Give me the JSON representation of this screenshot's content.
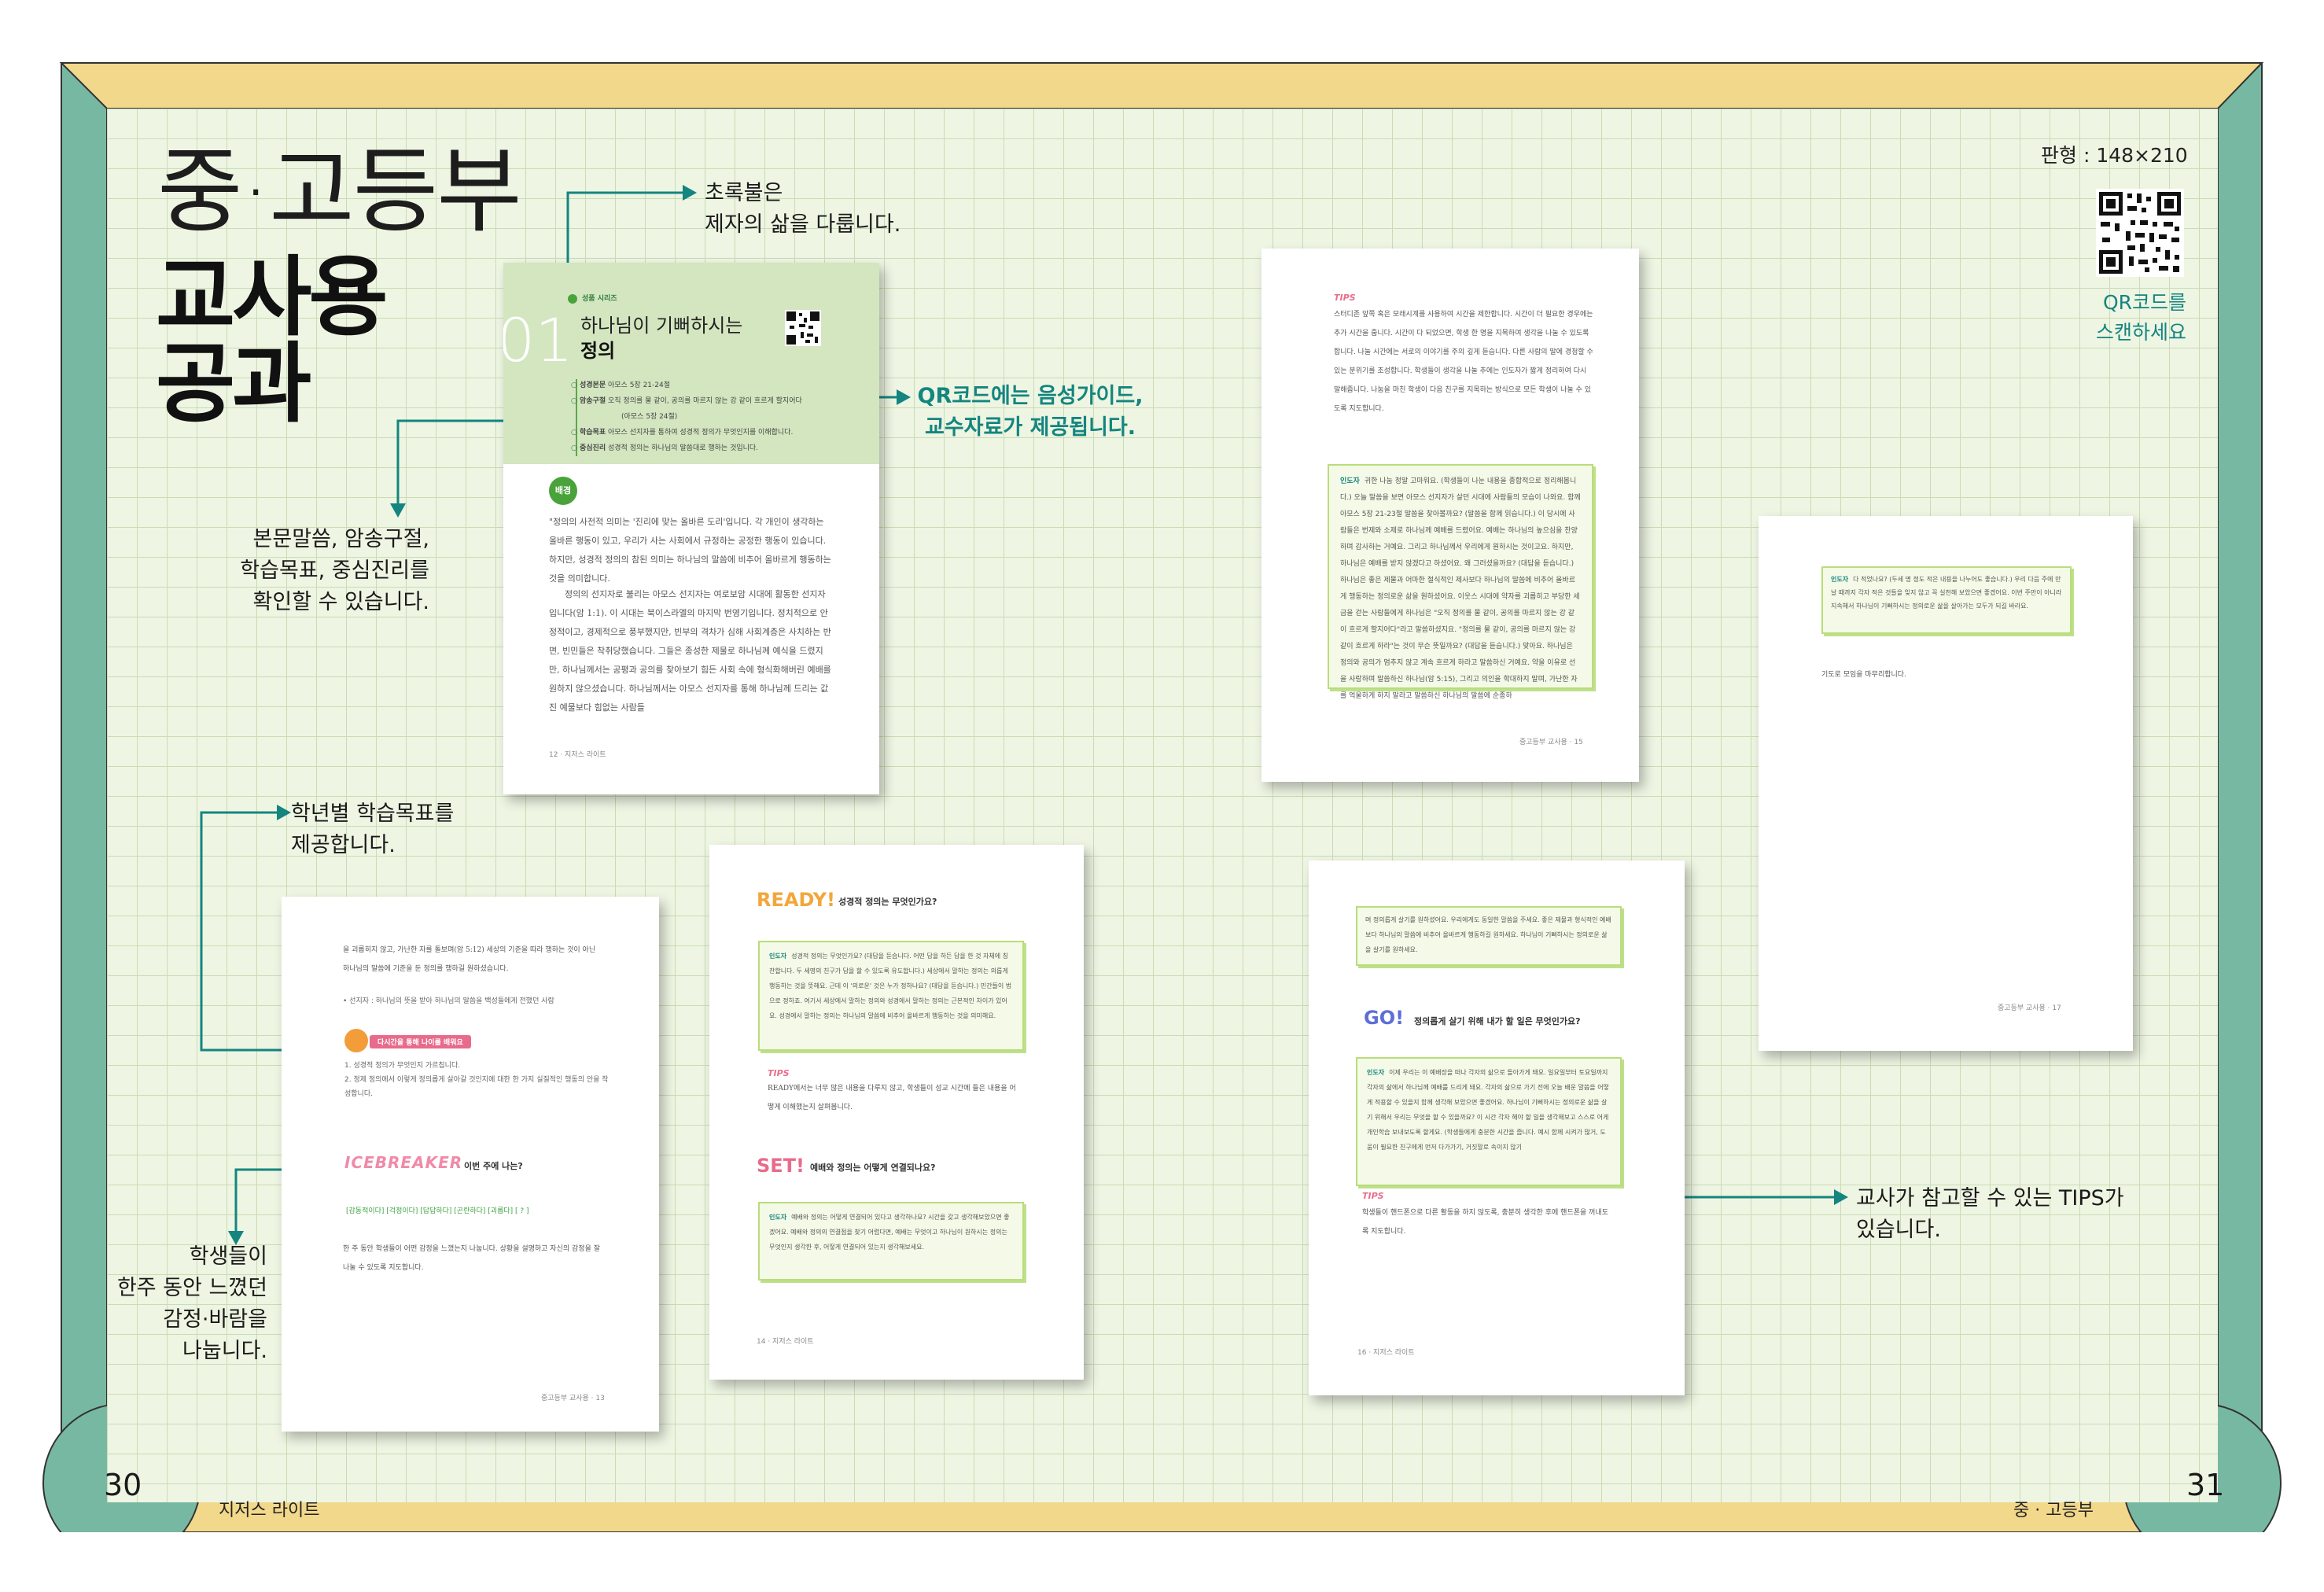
{
  "hero": {
    "line1": "중·고등부",
    "line2": "교사용",
    "line3": "공과"
  },
  "format": {
    "label": "판형 : 148×210",
    "qr_caption_line1": "QR코드를",
    "qr_caption_line2": "스캔하세요"
  },
  "callouts": {
    "green_light_line1": "초록불은",
    "green_light_line2": "제자의 삶을 다룹니다.",
    "qr_line1": "QR코드에는 음성가이드,",
    "qr_line2": "교수자료가 제공됩니다.",
    "scripture_line1": "본문말씀, 암송구절,",
    "scripture_line2": "학습목표, 중심진리를",
    "scripture_line3": "확인할 수 있습니다.",
    "grade_line1": "학년별 학습목표를",
    "grade_line2": "제공합니다.",
    "students_line1": "학생들이",
    "students_line2": "한주 동안 느꼈던",
    "students_line3": "감정·바람을",
    "students_line4": "나눕니다.",
    "tips_line1": "교사가 참고할 수 있는 TIPS가",
    "tips_line2": "있습니다."
  },
  "lesson_page": {
    "series_label": "성품 시리즈",
    "number": "01",
    "title_light": "하나님이 기뻐하시는",
    "title_bold": "정의",
    "items": [
      {
        "key": "성경본문",
        "value": "아모스 5장 21-24절"
      },
      {
        "key": "암송구절",
        "value": "오직 정의를 물 같이, 공의를 마르지 않는 강 같이 흐르게 할지어다"
      },
      {
        "key": "",
        "value": "(아모스 5장 24절)"
      },
      {
        "key": "학습목표",
        "value": "아모스 선지자를 통하여 성경적 정의가 무엇인지를 이해합니다."
      },
      {
        "key": "중심진리",
        "value": "성경적 정의는 하나님의 말씀대로 행하는 것입니다."
      }
    ],
    "background_badge": "배경",
    "paragraphs": [
      "\"정의의 사전적 의미는 '진리에 맞는 올바른 도리'입니다. 각 개인이 생각하는 올바른 행동이 있고, 우리가 사는 사회에서 규정하는 공정한 행동이 있습니다. 하지만, 성경적 정의의 참된 의미는 하나님의 말씀에 비추어 올바르게 행동하는 것을 의미합니다.",
      "정의의 선지자로 불리는 아모스 선지자는 여로보암 시대에 활동한 선지자입니다(암 1:1). 이 시대는 북이스라엘의 마지막 번영기입니다. 정치적으로 안정적이고, 경제적으로 풍부했지만, 빈부의 격차가 심해 사회계층은 사치하는 반면, 빈민들은 착취당했습니다. 그들은 종성한 제물로 하나님께 예식을 드렸지만, 하나님께서는 공평과 공의를 찾아보기 힘든 사회 속에 형식화해버린 예배를 원하지 않으셨습니다. 하나님께서는 아모스 선지자를 통해 하나님께 드리는 값진 예물보다 힘없는 사람들"
    ],
    "footer": "12 · 지저스 라이트"
  },
  "page15": {
    "tips_title": "TIPS",
    "tips_text": "스터디존 앞쪽 혹은 모래시계를 사용하여 시간을 제한합니다. 시간이 더 필요한 경우에는 추가 시간을 줍니다. 시간이 다 되었으면, 학생 한 명을 지목하여 생각을 나눌 수 있도록 합니다. 나눌 시간에는 서로의 이야기를 주의 깊게 듣습니다. 다른 사람의 말에 경청할 수 있는 분위기를 조성합니다. 학생들이 생각을 나눌 추에는 인도자가 짧게 정리하여 다시 말해줍니다. 나눔을 마친 학생이 다음 친구를 지목하는 방식으로 모든 학생이 나눌 수 있도록 지도합니다.",
    "box_lead": "인도자",
    "box_text": "귀한 나눔 정말 고마워요. (학생들이 나눈 내용을 종합적으로 정리해봅니다.) 오늘 말씀을 보면 아모스 선지자가 살던 시대에 사람들의 모습이 나와요. 함께 아모스 5장 21-23절 말씀을 찾아볼까요? (말씀을 함께 읽습니다.) 이 당시에 사람들은 번제와 소제로 하나님께 예배를 드렸어요. 예배는 하나님의 높으심을 찬양하며 감사하는 거예요. 그리고 하나님께서 우리에게 원하시는 것이고요. 하지만, 하나님은 예배를 받지 않겠다고 하셨어요. 왜 그러셨을까요? (대답을 듣습니다.) 하나님은 좋은 제물과 어마한 절식적인 제사보다 하나님의 말씀에 비추어 올바르게 행동하는 정의로운 삶을 원하셨어요. 이웃스 시대에 약자를 괴롭히고 부당한 세금을 걷는 사람들에게 하나님은 \"오직 정의를 물 같이, 공의를 마르지 않는 강 같이 흐르게 할지어다\"라고 말씀하셨지요. \"정의를 물 같이, 공의를 마르지 않는 강 같이 흐르게 하라\"는 것이 무슨 뜻일까요? (대답을 듣습니다.) 맞아요. 하나님은 정의와 공의가 멈추지 않고 계속 흐르게 하라고 말씀하신 거예요. 약을 이유로 선을 사랑하며 말씀하신 하나님(암 5:15), 그리고 의인을 학대하지 말며, 가난한 자를 억울하게 하지 말라고 말씀하신 하나님의 말씀에 순종하",
    "footer": "중고등부 교사용 · 15"
  },
  "page17": {
    "box_lead": "인도자",
    "box_text": "다 적었나요? (두세 명 정도 적은 내용을 나누어도 좋습니다.) 우리 다음 주에 만날 때까지 각자 적은 것들을 잊지 않고 꼭 실천해 보았으면 좋겠어요. 이번 주만이 아니라 지속해서 하나님이 기뻐하시는 정의로운 삶을 살아가는 모두가 되길 바라요.",
    "closing": "기도로 모임을 마무리합니다.",
    "footer": "중고등부 교사용 · 17"
  },
  "page13": {
    "intro": "을 괴롭히지 않고, 가난한 자를 돌보며(암 5:12) 세상의 기준을 따라 행하는 것이 아닌 하나님의 말씀에 기준을 둔 정의를 행하길 원하셨습니다.",
    "note": "• 선지자 : 하나님의 뜻을 받아 하나님의 말씀을 백성들에게 전했던 사람",
    "banner": "다시간을 통해 나이를 배워요",
    "goals": [
      "1. 성경적 정의가 무엇인지 가르칩니다.",
      "2. 정제 정의에서 이렇게 정의롭게 살아갈 것인지에 대한 한 가지 실질적인 행동의 안을 작성합니다."
    ],
    "icebreaker": "ICEBREAKER",
    "icebreaker_q": "이번 주에 나는?",
    "emotions": "[감동적이다] [걱정이다] [답답하다] [곤란하다] [괴롭다] [ ? ]",
    "body": "한 주 동안 학생들이 어떤 감정을 느꼈는지 나눕니다. 상황을 설명하고 자신의 감정을 잘 나눌 수 있도록 지도합니다.",
    "footer": "중고등부 교사용 · 13"
  },
  "page14": {
    "ready_label": "READY!",
    "ready_q": "성경적 정의는 무엇인가요?",
    "ready_box_lead": "인도자",
    "ready_box_text": "성경적 정의는 무엇인가요? (대답을 듣습니다. 어떤 답을 하든 답을 한 것 자체에 칭찬합니다. 두 세명의 친구가 답을 할 수 있도록 유도합니다.) 세상에서 말하는 정의는 의롭게 행동하는 것을 뜻해요. 근데 이 '의로운' 것은 누가 정하나요? (대답을 듣습니다.) 민간들이 법으로 정하죠. 여기서 세상에서 말하는 정의와 성경에서 말하는 정의는 근본적인 차이가 있어요. 성경에서 말하는 정의는 하나님의 말씀에 비추어 올바르게 행동하는 것을 의미해요.",
    "tips_title": "TIPS",
    "tips_text": "READY에서는 너무 많은 내용을 다루지 않고, 학생들이 성교 시간에 들은 내용을 어떻게 이해했는지 살펴봅니다.",
    "set_label": "SET!",
    "set_q": "예배와 정의는 어떻게 연결되나요?",
    "set_box_lead": "인도자",
    "set_box_text": "예배와 정의는 어떻게 연결되어 있다고 생각하나요? 시간을 갖고 생각해보았으면 좋겠어요. 예배와 정의의 연결점을 찾기 어렵다면, 예배는 무엇이고 하나님이 원하시는 정의는 무엇인지 생각한 후, 어떻게 연결되어 있는지 생각해보세요.",
    "footer": "14 · 지저스 라이트"
  },
  "page16": {
    "top_text": "며 정의롭게 살기를 원하셨어요. 우리에게도 동일한 말씀을 주세요. 좋은 제물과 형식적인 예배보다 하나님의 말씀에 비추어 올바르게 행동하길 원하세요. 하나님이 기뻐하시는 정의로운 삶을 살기를 원하세요.",
    "go_label": "GO!",
    "go_q": "정의롭게 살기 위해 내가 할 일은 무엇인가요?",
    "go_box_lead": "인도자",
    "go_box_text": "이제 우리는 이 예배장을 떠나 각자의 삶으로 돌아가게 돼요. 일요일부터 토요일까지 각자의 삶에서 하나님께 예배를 드리게 돼요. 각자의 삶으로 가기 전에 오늘 배운 말씀을 어떻게 적용할 수 있을지 함께 생각해 보았으면 좋겠어요. 하나님이 기뻐하시는 정의로운 삶을 살기 위해서 우리는 무엇을 할 수 있을까요? 이 시간 각자 해야 할 일을 생각해보고 스스로 어게 개인학습 보내보도록 할게요. (학생들에게 충분한 시간을 줍니다. 예시 함께 시켜가 많거, 도움이 필요한 친구에게 먼저 다가가기, 거짓말로 속이지 않기",
    "tips_title": "TIPS",
    "tips_text": "학생들이 핸드폰으로 다른 활동을 하지 않도록, 충분히 생각한 후에 핸드폰을 꺼내도록 지도합니다.",
    "footer": "16 · 지저스 라이트"
  },
  "bottom_bar": {
    "left_number": "30",
    "right_number": "31",
    "left_label": "지저스 라이트",
    "right_label": "중 · 고등부"
  },
  "colors": {
    "frame_teal": "#77b8a3",
    "frame_yellow": "#f2d88a",
    "grid_bg": "#eef5e3",
    "accent_teal": "#14857f",
    "lesson_header_green": "#d3e6c0"
  }
}
